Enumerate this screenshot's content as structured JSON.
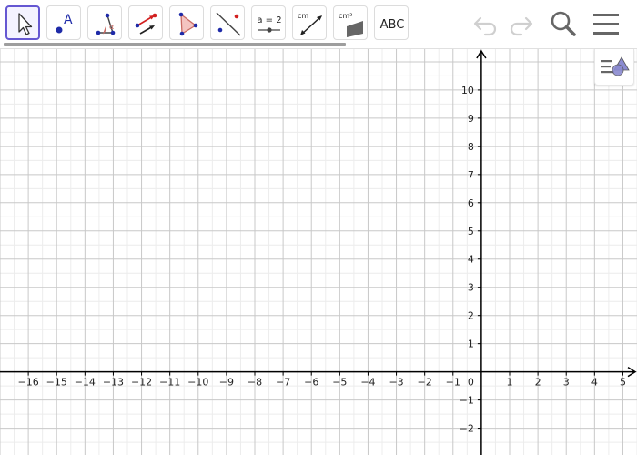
{
  "toolbar": {
    "tools": [
      {
        "name": "move-tool",
        "selected": true
      },
      {
        "name": "point-tool",
        "label": "A"
      },
      {
        "name": "angle-tool",
        "label": "α"
      },
      {
        "name": "vector-tool"
      },
      {
        "name": "polygon-tool"
      },
      {
        "name": "line-tool"
      },
      {
        "name": "slider-tool",
        "label": "a = 2"
      },
      {
        "name": "distance-tool",
        "label": "cm"
      },
      {
        "name": "area-tool",
        "label": "cm²"
      },
      {
        "name": "text-tool",
        "label": "ABC"
      }
    ],
    "actions": [
      {
        "name": "undo-icon"
      },
      {
        "name": "redo-icon"
      },
      {
        "name": "search-icon"
      },
      {
        "name": "menu-icon"
      }
    ]
  },
  "graphics": {
    "x_range": [
      -17,
      5.5
    ],
    "y_range": [
      -2.95,
      11.45
    ],
    "grid": true,
    "x_ticks": [
      -16,
      -15,
      -14,
      -13,
      -12,
      -11,
      -10,
      -9,
      -8,
      -7,
      -6,
      -5,
      -4,
      -3,
      -2,
      -1,
      1,
      2,
      3,
      4,
      5
    ],
    "y_ticks": [
      -2,
      -1,
      1,
      2,
      3,
      4,
      5,
      6,
      7,
      8,
      9,
      10
    ],
    "origin_label": "0"
  },
  "colors": {
    "accent": "#6557d2",
    "point_blue": "#1f2ba8",
    "vector_red": "#d22020",
    "polygon_fill": "#f4c4c1",
    "polygon_stroke": "#c96b64",
    "grid_major": "#c8c8c8",
    "grid_minor": "#ececec",
    "icon_grey": "#666666",
    "disabled_grey": "#cfcfcf",
    "axis": "#000000"
  }
}
